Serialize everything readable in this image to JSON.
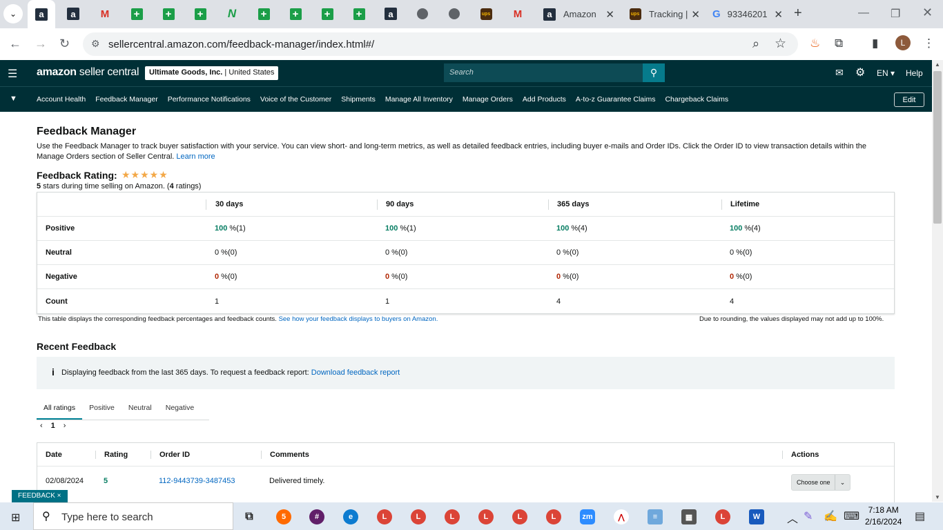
{
  "browser": {
    "tabs": [
      {
        "title": "Amazon",
        "icon": "amazon-icon"
      },
      {
        "title": "Tracking |",
        "icon": "ups-icon"
      },
      {
        "title": "93346201",
        "icon": "google-icon"
      }
    ],
    "url": "sellercentral.amazon.com/feedback-manager/index.html#/",
    "profile_initial": "L"
  },
  "header": {
    "logo_brand": "amazon",
    "logo_product": "seller central",
    "store_name": "Ultimate Goods, Inc.",
    "store_region": "United States",
    "search_placeholder": "Search",
    "language": "EN",
    "help": "Help"
  },
  "nav": {
    "items": [
      "Account Health",
      "Feedback Manager",
      "Performance Notifications",
      "Voice of the Customer",
      "Shipments",
      "Manage All Inventory",
      "Manage Orders",
      "Add Products",
      "A-to-z Guarantee Claims",
      "Chargeback Claims"
    ],
    "edit": "Edit"
  },
  "page": {
    "title": "Feedback Manager",
    "description": "Use the Feedback Manager to track buyer satisfaction with your service. You can view short- and long-term metrics, as well as detailed feedback entries, including buyer e-mails and Order IDs. Click the Order ID to view transaction details within the Manage Orders section of Seller Central.",
    "learn_more": "Learn more",
    "rating_title": "Feedback Rating:",
    "rating_stars": 5,
    "rating_sub_stars": "5",
    "rating_sub_mid": " stars during time selling on Amazon. (",
    "rating_sub_count": "4",
    "rating_sub_end": " ratings)"
  },
  "feedback_table": {
    "columns": [
      "30 days",
      "90 days",
      "365 days",
      "Lifetime"
    ],
    "rows": [
      {
        "label": "Positive",
        "type": "pos",
        "cells": [
          [
            "100",
            " %(1)"
          ],
          [
            "100",
            " %(1)"
          ],
          [
            "100",
            " %(4)"
          ],
          [
            "100",
            " %(4)"
          ]
        ]
      },
      {
        "label": "Neutral",
        "type": "plain",
        "cells": [
          [
            "0",
            " %(0)"
          ],
          [
            "0",
            " %(0)"
          ],
          [
            "0",
            " %(0)"
          ],
          [
            "0",
            " %(0)"
          ]
        ]
      },
      {
        "label": "Negative",
        "type": "neg",
        "cells": [
          [
            "0",
            " %(0)"
          ],
          [
            "0",
            " %(0)"
          ],
          [
            "0",
            " %(0)"
          ],
          [
            "0",
            " %(0)"
          ]
        ]
      },
      {
        "label": "Count",
        "type": "plain",
        "cells": [
          [
            "1",
            ""
          ],
          [
            "1",
            ""
          ],
          [
            "4",
            ""
          ],
          [
            "4",
            ""
          ]
        ]
      }
    ],
    "note_text": "This table displays the corresponding feedback percentages and feedback counts.",
    "note_link": "See how your feedback displays to buyers on Amazon.",
    "rounding_note": "Due to rounding, the values displayed may not add up to 100%."
  },
  "recent": {
    "title": "Recent Feedback",
    "info_text": "Displaying feedback from the last 365 days. To request a feedback report:",
    "info_link": "Download feedback report",
    "tabs": [
      "All ratings",
      "Positive",
      "Neutral",
      "Negative"
    ],
    "page": "1",
    "columns": [
      "Date",
      "Rating",
      "Order ID",
      "Comments",
      "Actions"
    ],
    "rows": [
      {
        "date": "02/08/2024",
        "rating": "5",
        "order_id": "112-9443739-3487453",
        "comment": "Delivered timely.",
        "action": "Choose one"
      }
    ]
  },
  "feedback_tag": "FEEDBACK ×",
  "taskbar": {
    "search_placeholder": "Type here to search",
    "time": "7:18 AM",
    "date": "2/16/2024",
    "badge": "5"
  }
}
